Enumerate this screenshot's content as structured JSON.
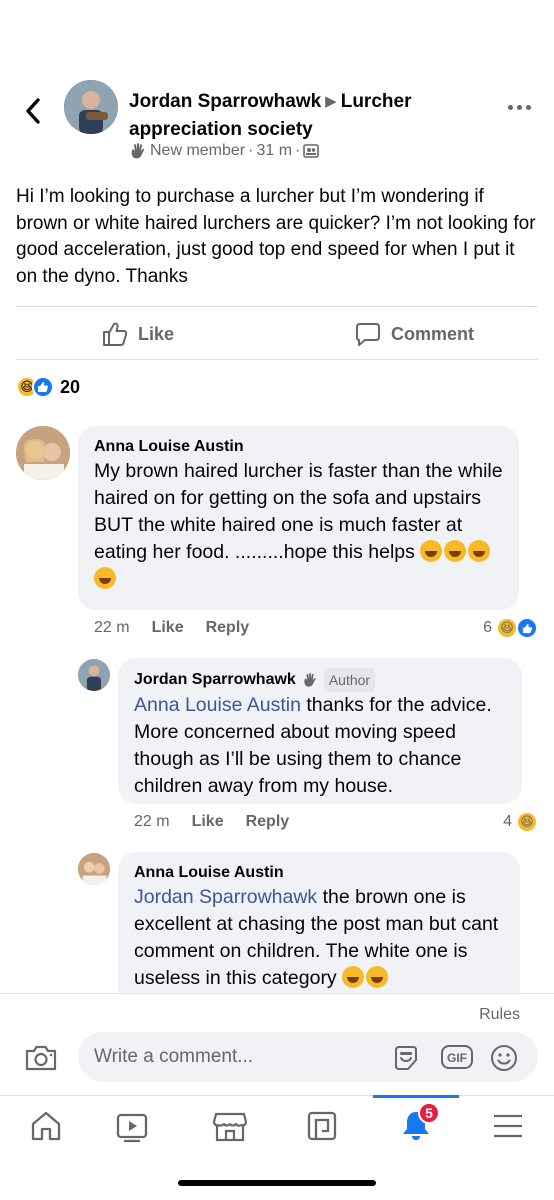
{
  "post": {
    "author": "Jordan Sparrowhawk",
    "group": "Lurcher appreciation society",
    "member_badge": "New member",
    "time": "31 m",
    "body": "Hi I’m looking to purchase a lurcher but I’m wondering if brown or white haired lurchers are quicker? I’m not looking for good acceleration, just good top end speed for when I put it on the dyno. Thanks",
    "like_label": "Like",
    "comment_label": "Comment",
    "reaction_count": "20"
  },
  "comments": [
    {
      "name": "Anna Louise Austin",
      "text": "My brown haired lurcher is faster than the while haired on for getting on the sofa and upstairs BUT the white haired one is much faster at eating her food. .........hope this helps",
      "time": "22 m",
      "like": "Like",
      "reply": "Reply",
      "reactions": "6"
    },
    {
      "name": "Jordan Sparrowhawk",
      "badge": "Author",
      "mention": "Anna Louise Austin",
      "text": " thanks for the advice. More concerned about moving speed though as I’ll be using them to chance children away from my house.",
      "time": "22 m",
      "like": "Like",
      "reply": "Reply",
      "reactions": "4"
    },
    {
      "name": "Anna Louise Austin",
      "mention": "Jordan Sparrowhawk",
      "text": " the brown one is excellent at chasing the post man but cant comment on children. The white one is useless in this category"
    }
  ],
  "composer": {
    "rules": "Rules",
    "placeholder": "Write a comment...",
    "gif": "GIF"
  },
  "nav": {
    "notifications_badge": "5",
    "tabs": [
      "home-icon",
      "video-icon",
      "marketplace-icon",
      "groups-icon",
      "bell-icon",
      "menu-icon"
    ]
  },
  "colors": {
    "accent": "#1877f2",
    "mention": "#385898",
    "badge": "#e41e3f"
  }
}
